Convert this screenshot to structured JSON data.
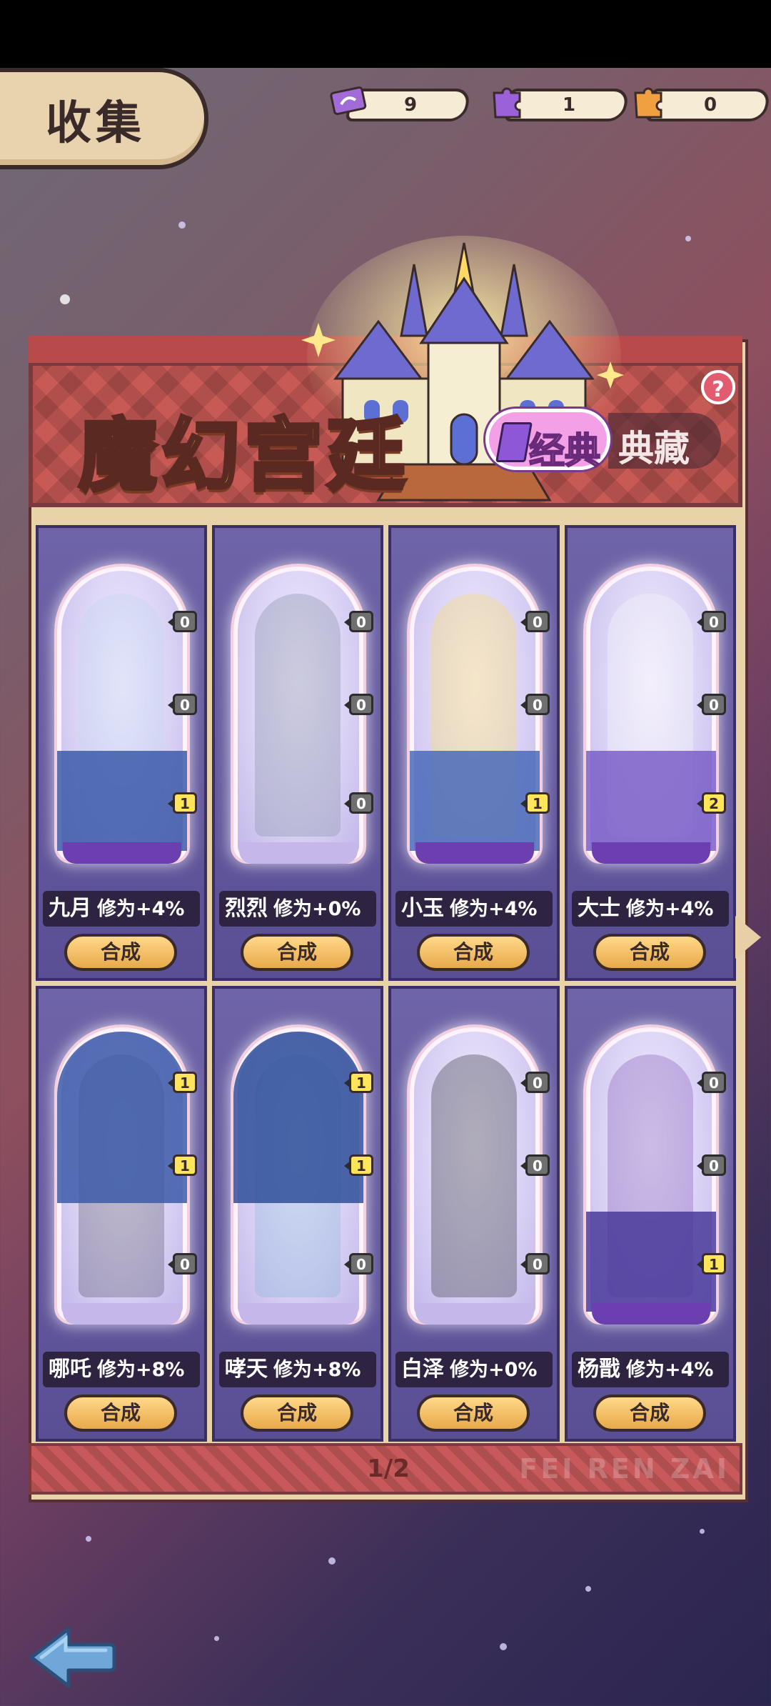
{
  "header": {
    "title": "收集",
    "resources": [
      {
        "icon": "ticket-icon",
        "value": "9",
        "color": "#a26bd8"
      },
      {
        "icon": "purple-puzzle-icon",
        "value": "1",
        "color": "#9a61d8"
      },
      {
        "icon": "orange-puzzle-icon",
        "value": "0",
        "color": "#f0a040"
      }
    ]
  },
  "banner": {
    "title": "魔幻宫廷",
    "tabs": {
      "classic": "经典",
      "treasure": "典藏"
    },
    "help": "?"
  },
  "cards": [
    {
      "name": "九月",
      "bonus": "修为+4%",
      "pieces": [
        "0",
        "0",
        "1"
      ],
      "button": "合成",
      "tint": "#c7d8f2"
    },
    {
      "name": "烈烈",
      "bonus": "修为+0%",
      "pieces": [
        "0",
        "0",
        "0"
      ],
      "button": "合成",
      "tint": "#9aa0b8"
    },
    {
      "name": "小玉",
      "bonus": "修为+4%",
      "pieces": [
        "0",
        "0",
        "1"
      ],
      "button": "合成",
      "tint": "#f3dc8a"
    },
    {
      "name": "大士",
      "bonus": "修为+4%",
      "pieces": [
        "0",
        "0",
        "2"
      ],
      "button": "合成",
      "tint": "#f0f0f8"
    },
    {
      "name": "哪吒",
      "bonus": "修为+8%",
      "pieces": [
        "1",
        "1",
        "0"
      ],
      "button": "合成",
      "tint": "#2a2a3a"
    },
    {
      "name": "哮天",
      "bonus": "修为+8%",
      "pieces": [
        "1",
        "1",
        "0"
      ],
      "button": "合成",
      "tint": "#7fb4d8"
    },
    {
      "name": "白泽",
      "bonus": "修为+0%",
      "pieces": [
        "0",
        "0",
        "0"
      ],
      "button": "合成",
      "tint": "#5a5a68"
    },
    {
      "name": "杨戬",
      "bonus": "修为+4%",
      "pieces": [
        "0",
        "0",
        "1"
      ],
      "button": "合成",
      "tint": "#9a7ac8"
    }
  ],
  "pagination": {
    "text": "1/2"
  },
  "footer_brand": "FEI REN ZAI",
  "nav": {
    "back": "back-arrow-icon",
    "next": "next-page-arrow-icon"
  }
}
